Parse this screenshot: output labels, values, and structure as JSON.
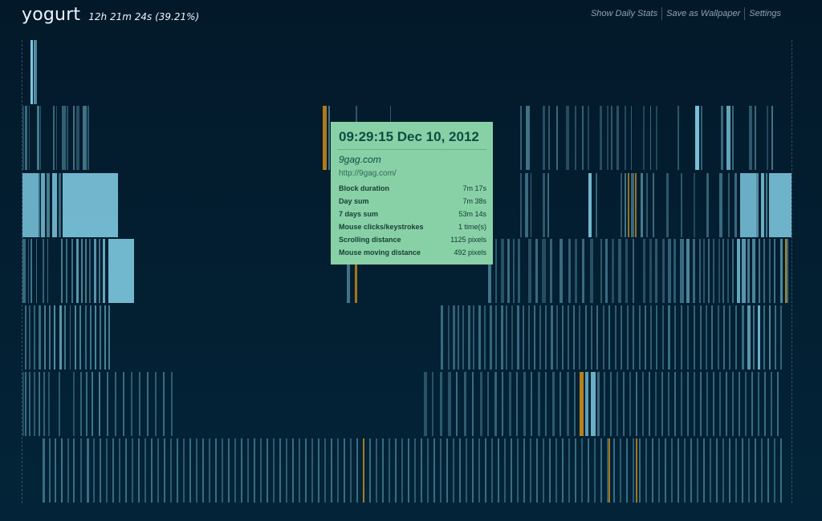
{
  "app": {
    "title": "yogurt",
    "summary": "12h 21m 24s (39.21%)"
  },
  "nav": {
    "links": [
      "Show Daily Stats",
      "Save as Wallpaper",
      "Settings"
    ]
  },
  "tooltip": {
    "time": "09:29:15 Dec 10, 2012",
    "site": "9gag.com",
    "url": "http://9gag.com/",
    "metrics": [
      {
        "label": "Block duration",
        "value": "7m 17s"
      },
      {
        "label": "Day sum",
        "value": "7m 38s"
      },
      {
        "label": "7 days sum",
        "value": "53m 14s"
      },
      {
        "label": "Mouse clicks/keystrokes",
        "value": "1 time(s)"
      },
      {
        "label": "Scrolling distance",
        "value": "1125 pixels"
      },
      {
        "label": "Mouse moving distance",
        "value": "492 pixels"
      }
    ]
  },
  "colors": {
    "background": "#03192a",
    "activity": "#7dc8df",
    "highlight": "#c1861a",
    "tooltip": "#88d1a6"
  }
}
